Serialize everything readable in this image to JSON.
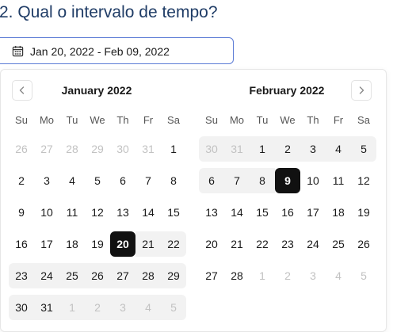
{
  "question": "2. Qual o intervalo de tempo?",
  "date_range_input": {
    "value": "Jan 20, 2022 - Feb 09, 2022",
    "icon": "calendar-icon"
  },
  "weekdays": [
    "Su",
    "Mo",
    "Tu",
    "We",
    "Th",
    "Fr",
    "Sa"
  ],
  "months": [
    {
      "title": "January 2022",
      "weeks": [
        [
          {
            "d": "26",
            "s": "outside"
          },
          {
            "d": "27",
            "s": "outside"
          },
          {
            "d": "28",
            "s": "outside"
          },
          {
            "d": "29",
            "s": "outside"
          },
          {
            "d": "30",
            "s": "outside"
          },
          {
            "d": "31",
            "s": "outside"
          },
          {
            "d": "1",
            "s": ""
          }
        ],
        [
          {
            "d": "2",
            "s": ""
          },
          {
            "d": "3",
            "s": ""
          },
          {
            "d": "4",
            "s": ""
          },
          {
            "d": "5",
            "s": ""
          },
          {
            "d": "6",
            "s": ""
          },
          {
            "d": "7",
            "s": ""
          },
          {
            "d": "8",
            "s": ""
          }
        ],
        [
          {
            "d": "9",
            "s": ""
          },
          {
            "d": "10",
            "s": ""
          },
          {
            "d": "11",
            "s": ""
          },
          {
            "d": "12",
            "s": ""
          },
          {
            "d": "13",
            "s": ""
          },
          {
            "d": "14",
            "s": ""
          },
          {
            "d": "15",
            "s": ""
          }
        ],
        [
          {
            "d": "16",
            "s": ""
          },
          {
            "d": "17",
            "s": ""
          },
          {
            "d": "18",
            "s": ""
          },
          {
            "d": "19",
            "s": ""
          },
          {
            "d": "20",
            "s": "selected"
          },
          {
            "d": "21",
            "s": "inrange"
          },
          {
            "d": "22",
            "s": "inrange"
          }
        ],
        [
          {
            "d": "23",
            "s": "inrange"
          },
          {
            "d": "24",
            "s": "inrange"
          },
          {
            "d": "25",
            "s": "inrange"
          },
          {
            "d": "26",
            "s": "inrange"
          },
          {
            "d": "27",
            "s": "inrange"
          },
          {
            "d": "28",
            "s": "inrange"
          },
          {
            "d": "29",
            "s": "inrange"
          }
        ],
        [
          {
            "d": "30",
            "s": "inrange"
          },
          {
            "d": "31",
            "s": "inrange"
          },
          {
            "d": "1",
            "s": "outside inrange"
          },
          {
            "d": "2",
            "s": "outside inrange"
          },
          {
            "d": "3",
            "s": "outside inrange"
          },
          {
            "d": "4",
            "s": "outside inrange"
          },
          {
            "d": "5",
            "s": "outside inrange"
          }
        ]
      ]
    },
    {
      "title": "February 2022",
      "weeks": [
        [
          {
            "d": "30",
            "s": "outside inrange"
          },
          {
            "d": "31",
            "s": "outside inrange"
          },
          {
            "d": "1",
            "s": "inrange"
          },
          {
            "d": "2",
            "s": "inrange"
          },
          {
            "d": "3",
            "s": "inrange"
          },
          {
            "d": "4",
            "s": "inrange"
          },
          {
            "d": "5",
            "s": "inrange"
          }
        ],
        [
          {
            "d": "6",
            "s": "inrange"
          },
          {
            "d": "7",
            "s": "inrange"
          },
          {
            "d": "8",
            "s": "inrange"
          },
          {
            "d": "9",
            "s": "selected"
          },
          {
            "d": "10",
            "s": ""
          },
          {
            "d": "11",
            "s": ""
          },
          {
            "d": "12",
            "s": ""
          }
        ],
        [
          {
            "d": "13",
            "s": ""
          },
          {
            "d": "14",
            "s": ""
          },
          {
            "d": "15",
            "s": ""
          },
          {
            "d": "16",
            "s": ""
          },
          {
            "d": "17",
            "s": ""
          },
          {
            "d": "18",
            "s": ""
          },
          {
            "d": "19",
            "s": ""
          }
        ],
        [
          {
            "d": "20",
            "s": ""
          },
          {
            "d": "21",
            "s": ""
          },
          {
            "d": "22",
            "s": ""
          },
          {
            "d": "23",
            "s": ""
          },
          {
            "d": "24",
            "s": ""
          },
          {
            "d": "25",
            "s": ""
          },
          {
            "d": "26",
            "s": ""
          }
        ],
        [
          {
            "d": "27",
            "s": ""
          },
          {
            "d": "28",
            "s": ""
          },
          {
            "d": "1",
            "s": "outside"
          },
          {
            "d": "2",
            "s": "outside"
          },
          {
            "d": "3",
            "s": "outside"
          },
          {
            "d": "4",
            "s": "outside"
          },
          {
            "d": "5",
            "s": "outside"
          }
        ]
      ]
    }
  ],
  "nav": {
    "prev_icon": "chevron-left-icon",
    "next_icon": "chevron-right-icon"
  },
  "colors": {
    "title": "#1f3c66",
    "input_border": "#5b7bd5",
    "selected_bg": "#111111",
    "range_bg": "#f2f2f2",
    "outside_text": "#c2c2c2"
  }
}
